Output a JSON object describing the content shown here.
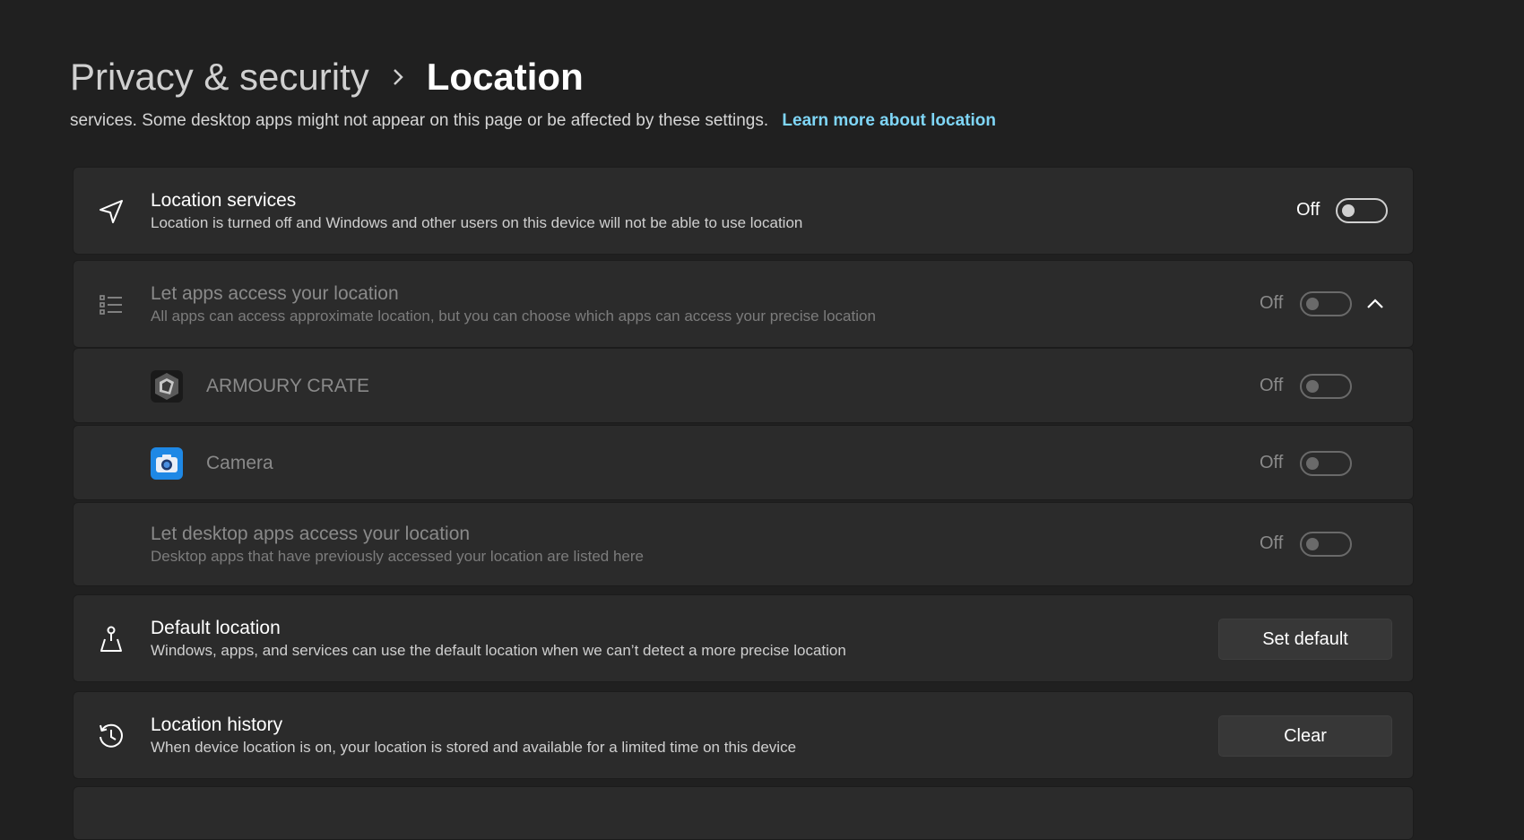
{
  "breadcrumb": {
    "parent": "Privacy & security",
    "current": "Location"
  },
  "description": {
    "text": "services. Some desktop apps might not appear on this page or be affected by these settings.",
    "link": "Learn more about location"
  },
  "location_services": {
    "title": "Location services",
    "subtitle": "Location is turned off and Windows and other users on this device will not be able to use location",
    "state": "Off",
    "icon": "navigation-arrow-icon"
  },
  "let_apps": {
    "title": "Let apps access your location",
    "subtitle": "All apps can access approximate location, but you can choose which apps can access your precise location",
    "state": "Off",
    "icon": "list-icon"
  },
  "apps": [
    {
      "name": "ARMOURY CRATE",
      "state": "Off",
      "icon": "armoury-crate-icon"
    },
    {
      "name": "Camera",
      "state": "Off",
      "icon": "camera-icon"
    }
  ],
  "desktop_apps": {
    "title": "Let desktop apps access your location",
    "subtitle": "Desktop apps that have previously accessed your location are listed here",
    "state": "Off"
  },
  "default_location": {
    "title": "Default location",
    "subtitle": "Windows, apps, and services can use the default location when we can’t detect a more precise location",
    "button": "Set default",
    "icon": "map-pin-person-icon"
  },
  "location_history": {
    "title": "Location history",
    "subtitle": "When device location is on, your location is stored and available for a limited time on this device",
    "button": "Clear",
    "icon": "history-icon"
  },
  "colors": {
    "background": "#202020",
    "card": "#2b2b2b",
    "link": "#7fd6f7",
    "camera_blue": "#1e88e5"
  }
}
